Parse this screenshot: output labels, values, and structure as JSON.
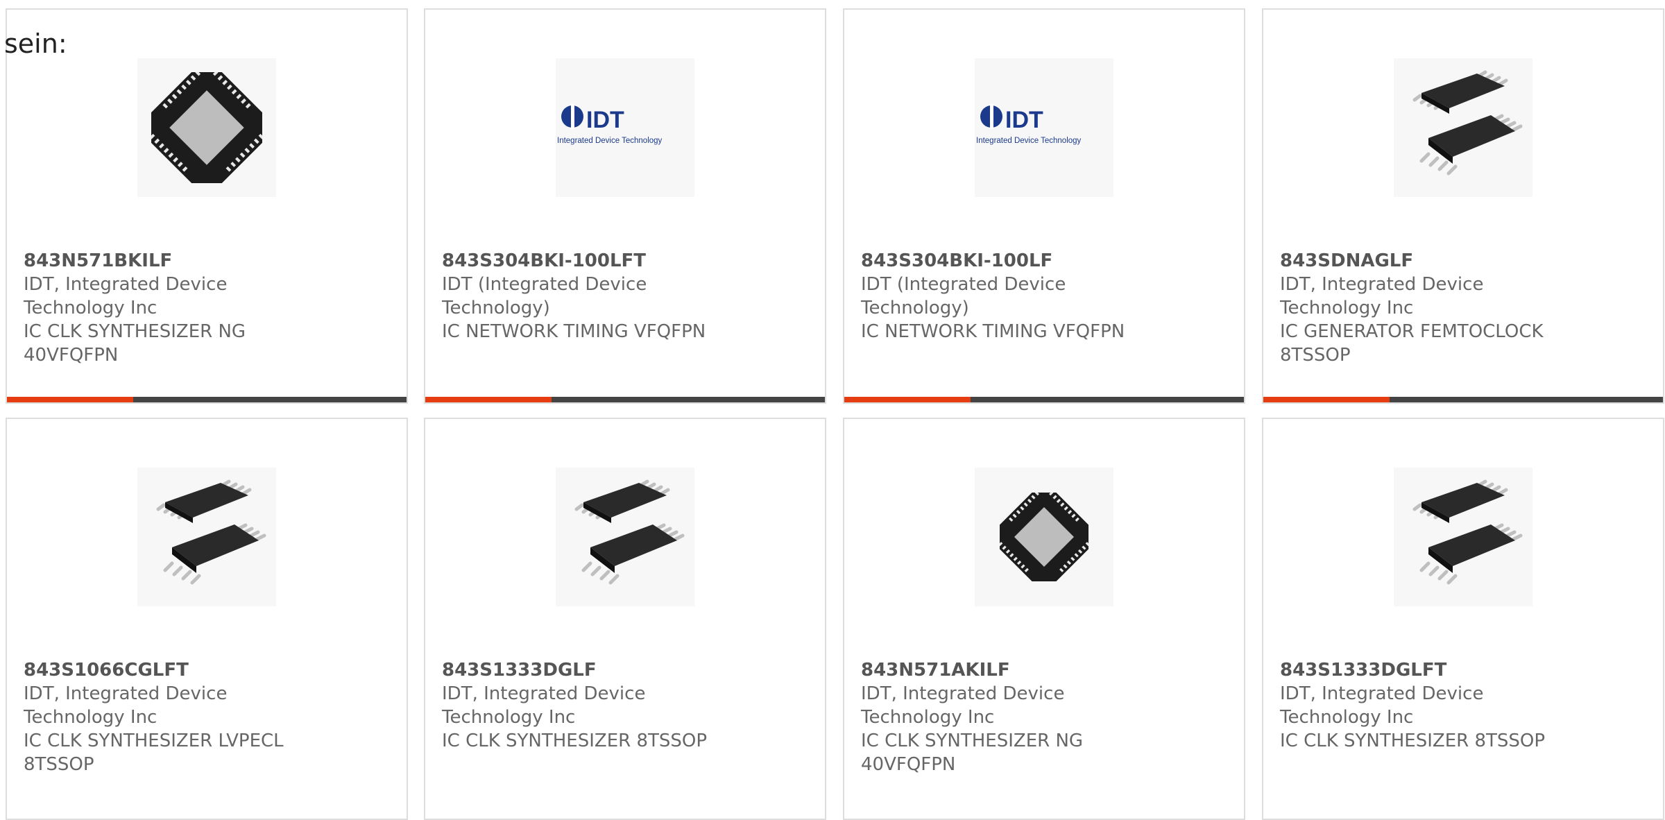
{
  "page": {
    "label_fragment": "sein:"
  },
  "colors": {
    "accent": "#e63c12",
    "bar": "#444444",
    "border": "#dddddd",
    "text": "#666666"
  },
  "products": [
    {
      "part_number": "843N571BKILF",
      "manufacturer_line1": "IDT, Integrated Device",
      "manufacturer_line2": "Technology Inc",
      "desc_line1": "IC CLK SYNTHESIZER NG",
      "desc_line2": "40VFQFPN",
      "image": "qfn-chip"
    },
    {
      "part_number": "843S304BKI-100LFT",
      "manufacturer_line1": "IDT (Integrated Device",
      "manufacturer_line2": "Technology)",
      "desc_line1": "IC NETWORK TIMING VFQFPN",
      "desc_line2": "",
      "image": "idt-logo"
    },
    {
      "part_number": "843S304BKI-100LF",
      "manufacturer_line1": "IDT (Integrated Device",
      "manufacturer_line2": "Technology)",
      "desc_line1": "IC NETWORK TIMING VFQFPN",
      "desc_line2": "",
      "image": "idt-logo"
    },
    {
      "part_number": "843SDNAGLF",
      "manufacturer_line1": "IDT, Integrated Device",
      "manufacturer_line2": "Technology Inc",
      "desc_line1": "IC GENERATOR FEMTOCLOCK",
      "desc_line2": "8TSSOP",
      "image": "tssop-chip"
    },
    {
      "part_number": "843S1066CGLFT",
      "manufacturer_line1": "IDT, Integrated Device",
      "manufacturer_line2": "Technology Inc",
      "desc_line1": "IC CLK SYNTHESIZER LVPECL",
      "desc_line2": "8TSSOP",
      "image": "tssop-chip"
    },
    {
      "part_number": "843S1333DGLF",
      "manufacturer_line1": "IDT, Integrated Device",
      "manufacturer_line2": "Technology Inc",
      "desc_line1": "IC CLK SYNTHESIZER 8TSSOP",
      "desc_line2": "",
      "image": "tssop-chip"
    },
    {
      "part_number": "843N571AKILF",
      "manufacturer_line1": "IDT, Integrated Device",
      "manufacturer_line2": "Technology Inc",
      "desc_line1": "IC CLK SYNTHESIZER NG",
      "desc_line2": "40VFQFPN",
      "image": "qfn-chip"
    },
    {
      "part_number": "843S1333DGLFT",
      "manufacturer_line1": "IDT, Integrated Device",
      "manufacturer_line2": "Technology Inc",
      "desc_line1": "IC CLK SYNTHESIZER 8TSSOP",
      "desc_line2": "",
      "image": "tssop-chip"
    }
  ],
  "logo": {
    "mark": "IDT",
    "tagline": "Integrated Device Technology"
  }
}
